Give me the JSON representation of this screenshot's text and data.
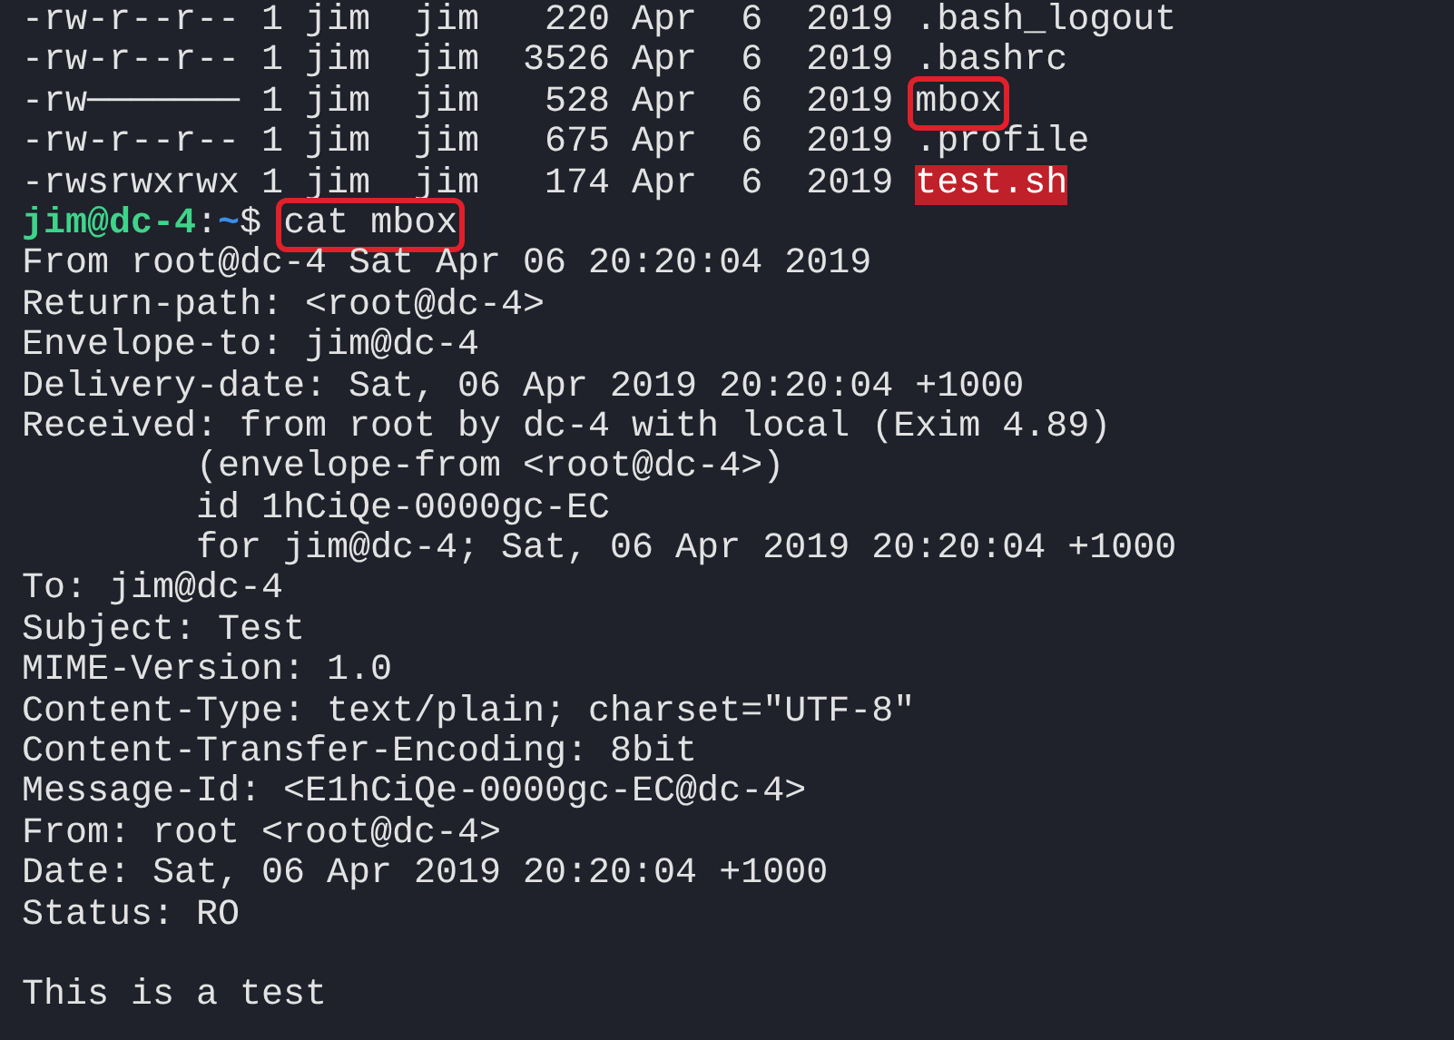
{
  "lines": [
    {
      "kind": "listing",
      "text": "-rw-r--r-- 1 jim  jim   220 Apr  6  2019 ",
      "name": ".bash_logout",
      "setuid": false,
      "marked": false
    },
    {
      "kind": "listing",
      "text": "-rw-r--r-- 1 jim  jim  3526 Apr  6  2019 ",
      "name": ".bashrc",
      "setuid": false,
      "marked": false
    },
    {
      "kind": "listing",
      "text": "-rw─────── 1 jim  jim   528 Apr  6  2019 ",
      "name": "mbox",
      "setuid": false,
      "marked": true
    },
    {
      "kind": "listing",
      "text": "-rw-r--r-- 1 jim  jim   675 Apr  6  2019 ",
      "name": ".profile",
      "setuid": false,
      "marked": false
    },
    {
      "kind": "listing",
      "text": "-rwsrwxrwx 1 jim  jim   174 Apr  6  2019 ",
      "name": "test.sh",
      "setuid": true,
      "marked": false
    },
    {
      "kind": "prompt",
      "user_host": "jim@dc-4",
      "separator": ":",
      "path": "~",
      "symbol": "$",
      "command": "cat mbox",
      "marked": true
    },
    {
      "kind": "text",
      "text": "From root@dc-4 Sat Apr 06 20:20:04 2019"
    },
    {
      "kind": "text",
      "text": "Return-path: <root@dc-4>"
    },
    {
      "kind": "text",
      "text": "Envelope-to: jim@dc-4"
    },
    {
      "kind": "text",
      "text": "Delivery-date: Sat, 06 Apr 2019 20:20:04 +1000"
    },
    {
      "kind": "text",
      "text": "Received: from root by dc-4 with local (Exim 4.89)"
    },
    {
      "kind": "text",
      "text": "        (envelope-from <root@dc-4>)"
    },
    {
      "kind": "text",
      "text": "        id 1hCiQe-0000gc-EC"
    },
    {
      "kind": "text",
      "text": "        for jim@dc-4; Sat, 06 Apr 2019 20:20:04 +1000"
    },
    {
      "kind": "text",
      "text": "To: jim@dc-4"
    },
    {
      "kind": "text",
      "text": "Subject: Test"
    },
    {
      "kind": "text",
      "text": "MIME-Version: 1.0"
    },
    {
      "kind": "text",
      "text": "Content-Type: text/plain; charset=\"UTF-8\""
    },
    {
      "kind": "text",
      "text": "Content-Transfer-Encoding: 8bit"
    },
    {
      "kind": "text",
      "text": "Message-Id: <E1hCiQe-0000gc-EC@dc-4>"
    },
    {
      "kind": "text",
      "text": "From: root <root@dc-4>"
    },
    {
      "kind": "text",
      "text": "Date: Sat, 06 Apr 2019 20:20:04 +1000"
    },
    {
      "kind": "text",
      "text": "Status: RO"
    },
    {
      "kind": "blank"
    },
    {
      "kind": "text",
      "text": "This is a test"
    }
  ]
}
